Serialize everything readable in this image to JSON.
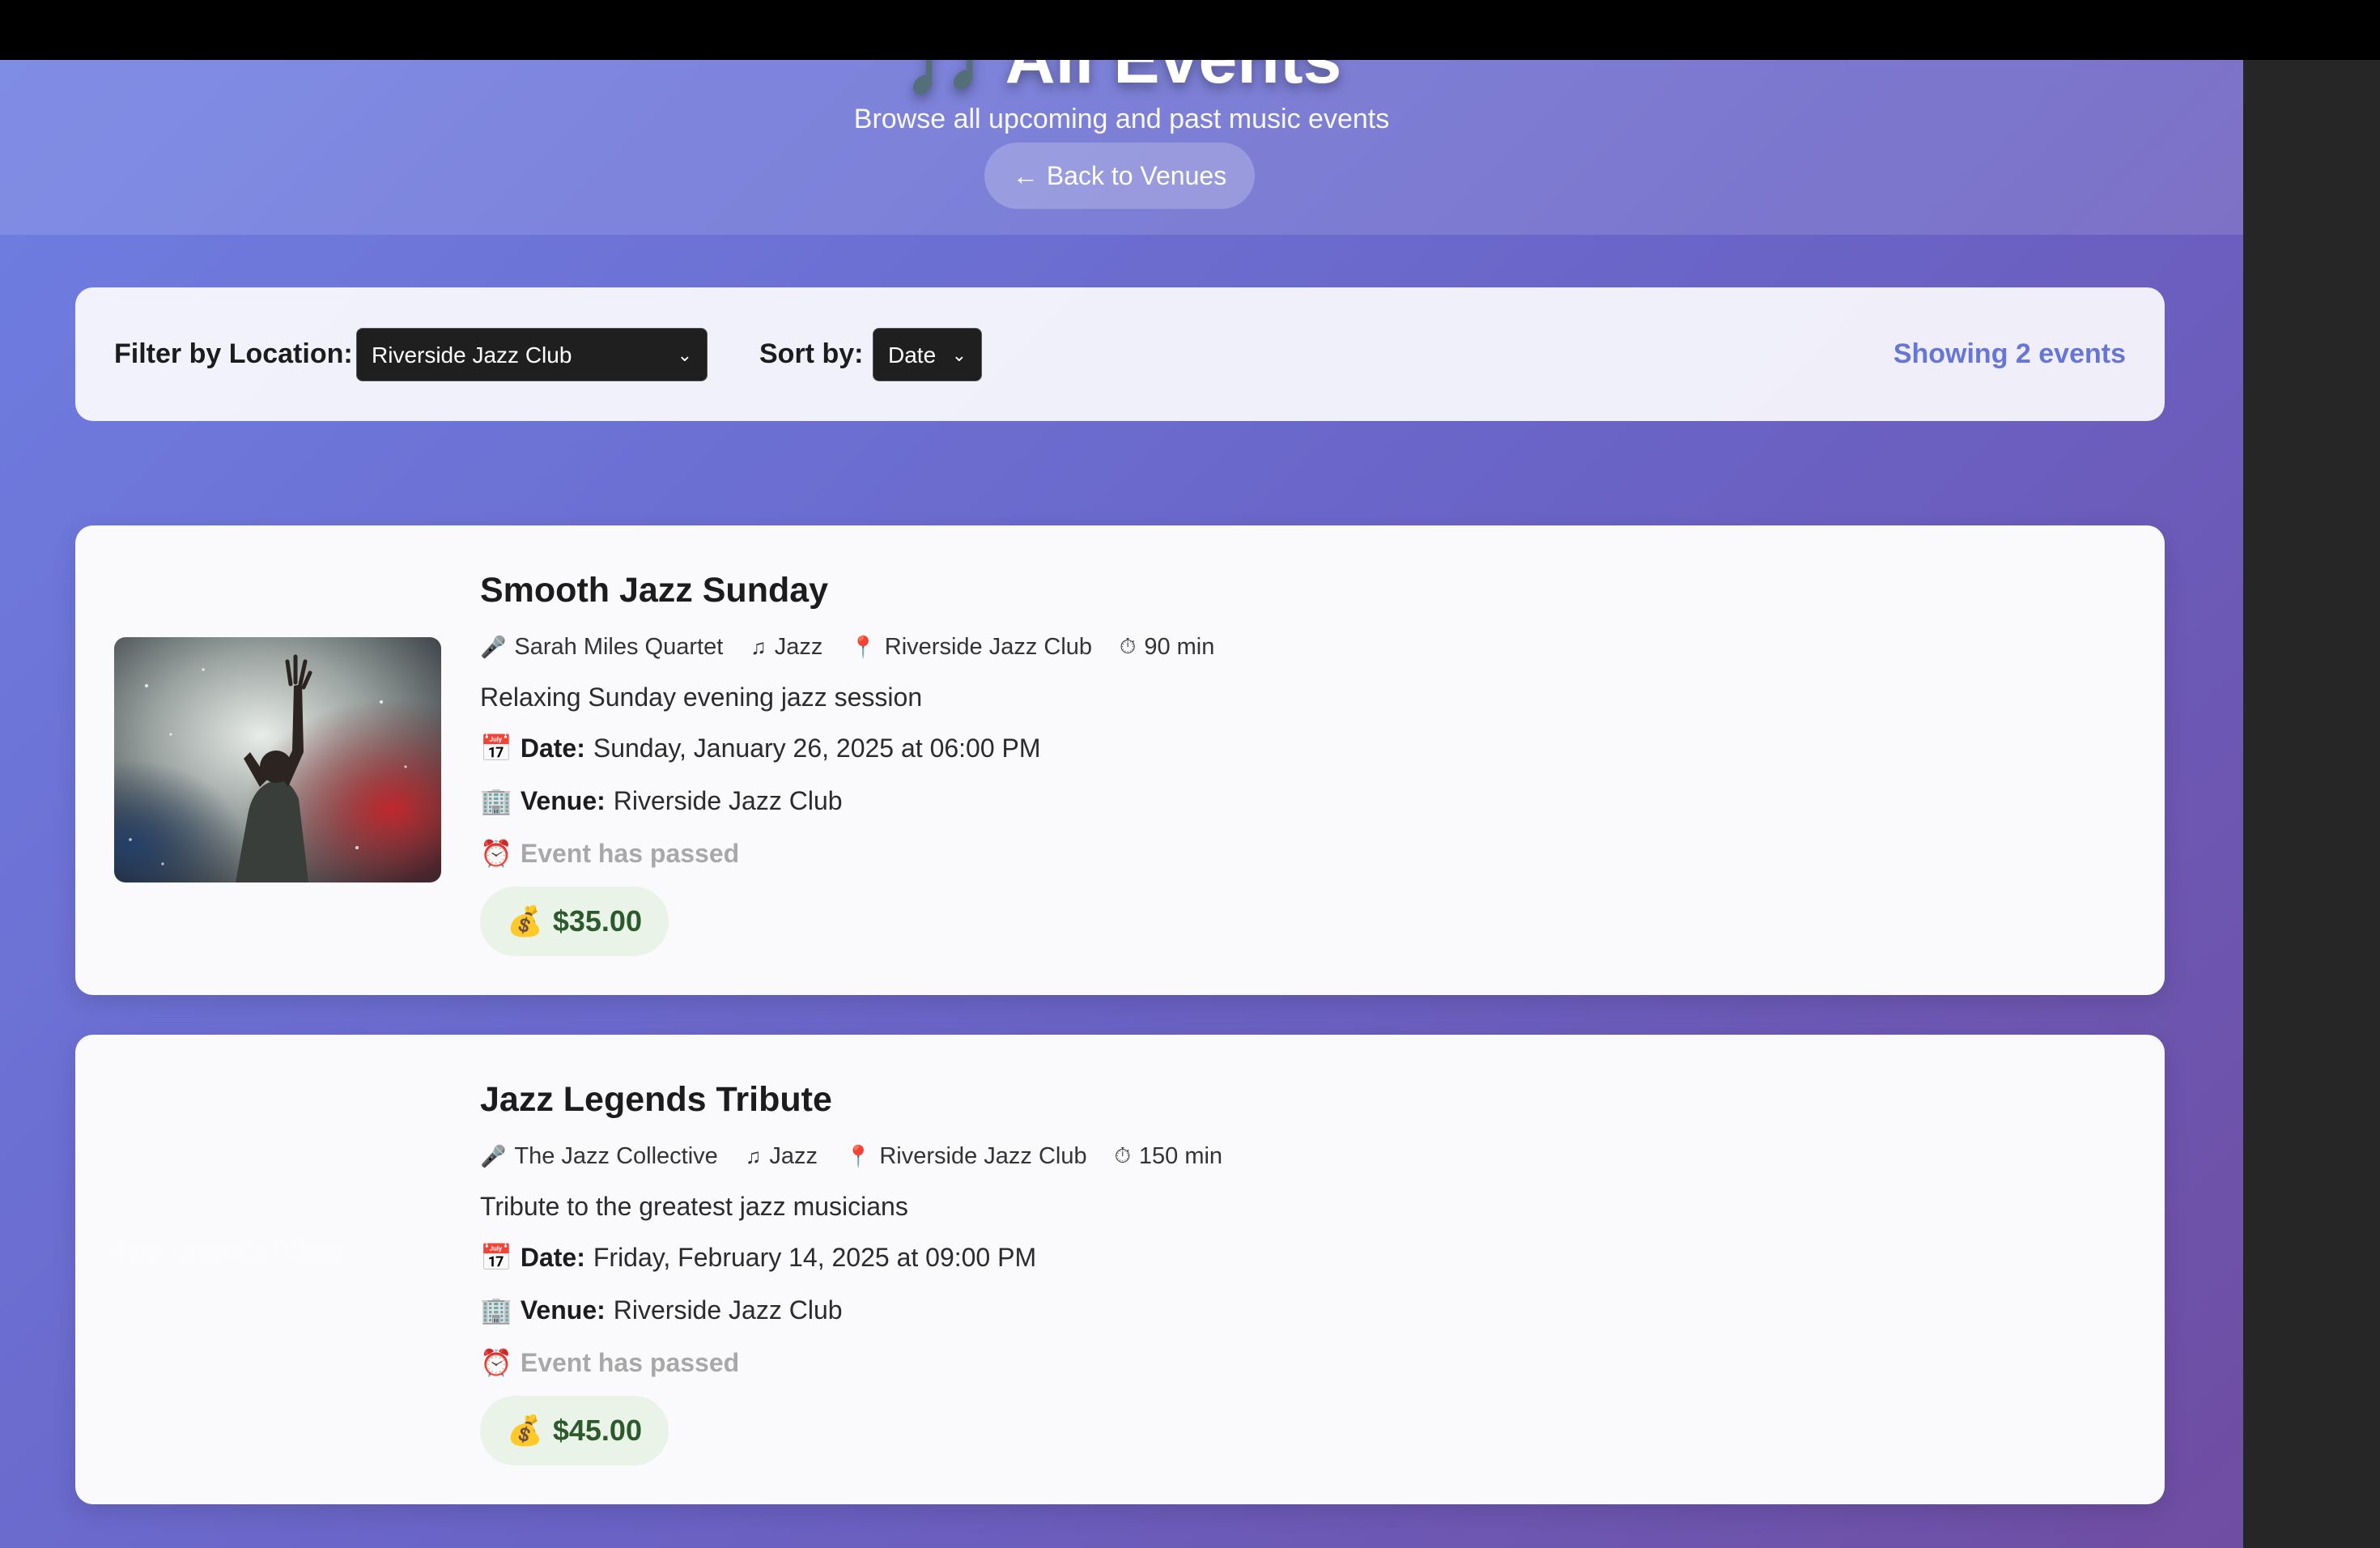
{
  "header": {
    "title": "🎵 All Events",
    "subtitle": "Browse all upcoming and past music events",
    "back_label": "Back to Venues",
    "back_icon": "←"
  },
  "filters": {
    "location_label": "Filter by Location:",
    "location_value": "Riverside Jazz Club",
    "sort_label": "Sort by:",
    "sort_value": "Date",
    "showing_text": "Showing 2 events"
  },
  "events": [
    {
      "title": "Smooth Jazz Sunday",
      "artist": "Sarah Miles Quartet",
      "genre": "Jazz",
      "location": "Riverside Jazz Club",
      "duration": "90 min",
      "description": "Relaxing Sunday evening jazz session",
      "date_label": "Date:",
      "date": "Sunday, January 26, 2025 at 06:00 PM",
      "venue_label": "Venue:",
      "venue": "Riverside Jazz Club",
      "status": "Event has passed",
      "price": "$35.00",
      "image_alt": ""
    },
    {
      "title": "Jazz Legends Tribute",
      "artist": "The Jazz Collective",
      "genre": "Jazz",
      "location": "Riverside Jazz Club",
      "duration": "150 min",
      "description": "Tribute to the greatest jazz musicians",
      "date_label": "Date:",
      "date": "Friday, February 14, 2025 at 09:00 PM",
      "venue_label": "Venue:",
      "venue": "Riverside Jazz Club",
      "status": "Event has passed",
      "price": "$45.00",
      "image_alt": "Jazz Legends Tribute"
    }
  ],
  "icons": {
    "artist": "microphone-icon",
    "genre": "music-note-icon",
    "location": "pin-icon",
    "duration": "stopwatch-icon",
    "date": "calendar-icon",
    "venue": "building-icon",
    "status": "alarm-clock-icon",
    "price": "money-bag-icon"
  },
  "colors": {
    "gradient_start": "#6f7fe2",
    "gradient_end": "#6f4da2",
    "accent": "#6675d8",
    "price_bg": "#e9f3e7",
    "price_text": "#2c5a2c",
    "passed_text": "#a8a8a8"
  }
}
